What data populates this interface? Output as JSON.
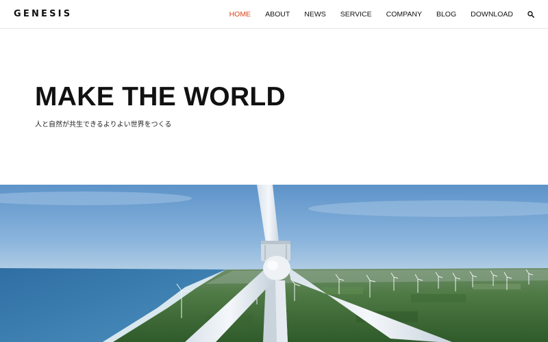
{
  "header": {
    "logo": "GENESIS",
    "nav": [
      {
        "label": "HOME",
        "active": true
      },
      {
        "label": "ABOUT",
        "active": false
      },
      {
        "label": "NEWS",
        "active": false
      },
      {
        "label": "SERVICE",
        "active": false
      },
      {
        "label": "COMPANY",
        "active": false
      },
      {
        "label": "BLOG",
        "active": false
      },
      {
        "label": "DOWNLOAD",
        "active": false
      }
    ],
    "search_icon": "search-icon"
  },
  "hero": {
    "title": "MAKE THE WORLD",
    "subtitle": "人と自然が共生できるよりよい世界をつくる"
  },
  "colors": {
    "accent": "#d9461b",
    "text": "#111111",
    "sky": "#6f9fcf",
    "sea": "#3f7fae",
    "land": "#3e6a3a"
  }
}
